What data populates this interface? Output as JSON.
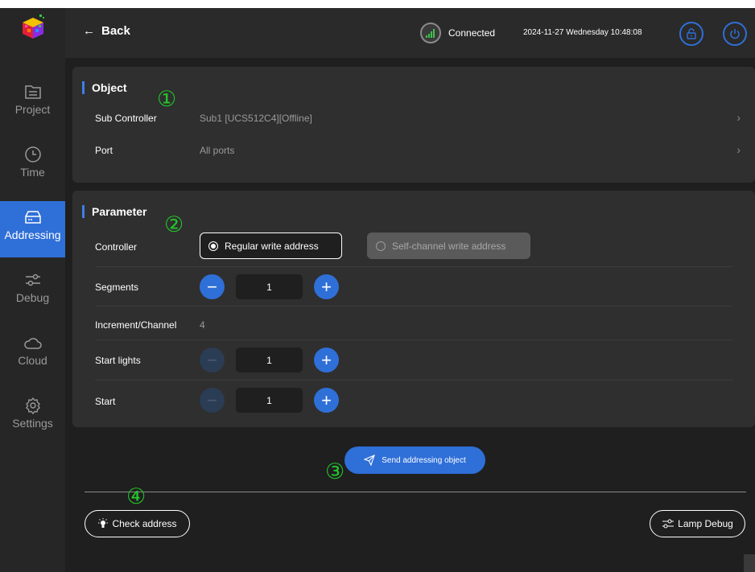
{
  "topbar": {
    "back_label": "Back",
    "connection_status": "Connected",
    "datetime": "2024-11-27 Wednesday 10:48:08"
  },
  "sidebar": {
    "items": [
      {
        "label": "Project",
        "icon": "project-icon",
        "active": false
      },
      {
        "label": "Time",
        "icon": "clock-icon",
        "active": false
      },
      {
        "label": "Addressing",
        "icon": "addressing-icon",
        "active": true
      },
      {
        "label": "Debug",
        "icon": "sliders-icon",
        "active": false
      },
      {
        "label": "Cloud",
        "icon": "cloud-icon",
        "active": false
      },
      {
        "label": "Settings",
        "icon": "gear-icon",
        "active": false
      }
    ]
  },
  "object": {
    "title": "Object",
    "sub_controller_label": "Sub Controller",
    "sub_controller_value": "Sub1 [UCS512C4][Offline]",
    "port_label": "Port",
    "port_value": "All ports"
  },
  "parameter": {
    "title": "Parameter",
    "controller_label": "Controller",
    "option_regular": "Regular write address",
    "option_self_channel": "Self-channel write address",
    "selected_option": "Regular write address",
    "segments_label": "Segments",
    "segments_value": "1",
    "increment_label": "Increment/Channel",
    "increment_value": "4",
    "start_lights_label": "Start lights",
    "start_lights_value": "1",
    "start_label": "Start",
    "start_value": "1"
  },
  "actions": {
    "send_label": "Send addressing object",
    "check_address_label": "Check address",
    "lamp_debug_label": "Lamp Debug"
  },
  "annotations": [
    "①",
    "②",
    "③",
    "④"
  ],
  "colors": {
    "accent": "#2f6fd8",
    "sidebar_bg": "#262626",
    "panel_bg": "#2f2f2f",
    "main_bg": "#1f1f1f",
    "annotation": "#22c52a"
  }
}
